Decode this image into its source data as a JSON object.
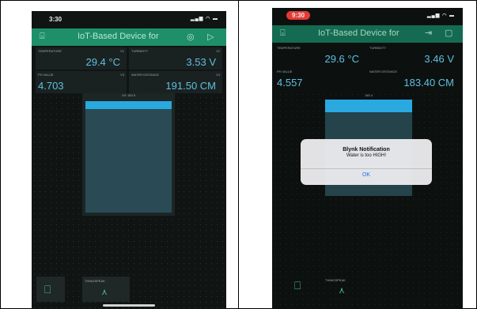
{
  "left": {
    "time": "3:30",
    "title": "IoT-Based Device for",
    "widgets": {
      "temperature": {
        "label": "TEMPERATURE",
        "pin": "V1",
        "value": "29.4 °C"
      },
      "turbidity": {
        "label": "TURBIDITY",
        "pin": "V2",
        "value": "3.53 V"
      },
      "ph": {
        "label": "PH VALUE",
        "pin": "V3",
        "value": "4.703"
      },
      "water": {
        "label": "WATER DISTANCE",
        "pin": "V4",
        "value": "191.50 CM"
      }
    },
    "tank_label": "V5: 183.5",
    "thingspeak_label": "THINGSPEAK"
  },
  "right": {
    "time": "9:30",
    "title": "IoT-Based Device for",
    "widgets": {
      "temperature": {
        "label": "TEMPERATURE",
        "value": "29.6 °C"
      },
      "turbidity": {
        "label": "TURBIDITY",
        "value": "3.46 V"
      },
      "ph": {
        "label": "PH VALUE",
        "value": "4.557"
      },
      "water": {
        "label": "WATER DISTANCE",
        "value": "183.40 CM"
      }
    },
    "tank_label": "183.4",
    "thingspeak_label": "THINGSPEAK",
    "notification": {
      "title": "Blynk Notification",
      "message": "Water is too HIGH!",
      "ok": "OK"
    }
  },
  "colors": {
    "accent_green": "#1e8f69",
    "value_cyan": "#5ec0e0",
    "tank_blue": "#2aa8e0",
    "status_red": "#e53935"
  }
}
